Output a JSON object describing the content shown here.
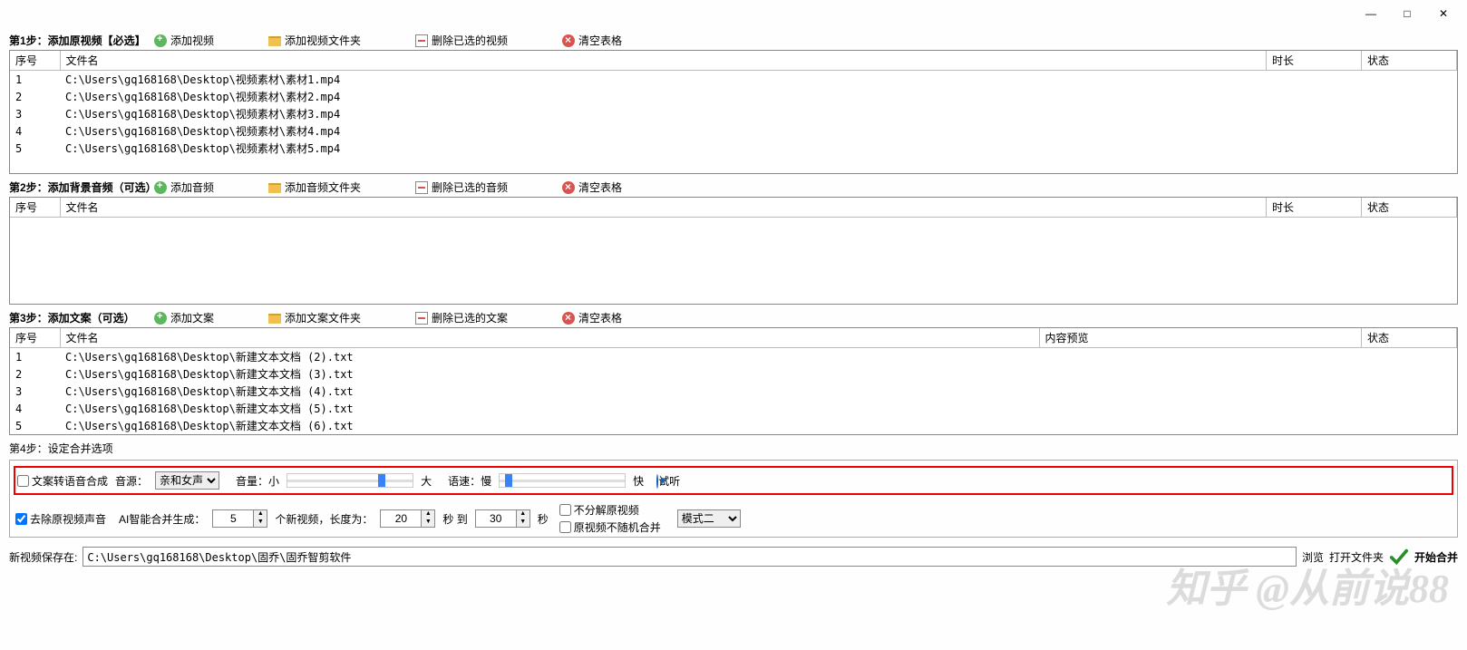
{
  "titlebar": {
    "min": "—",
    "max": "□",
    "close": "✕"
  },
  "step1": {
    "label": "第1步：添加原视频【必选】",
    "add": "添加视频",
    "add_folder": "添加视频文件夹",
    "delete_sel": "删除已选的视频",
    "clear": "清空表格",
    "cols": {
      "seq": "序号",
      "file": "文件名",
      "dur": "时长",
      "status": "状态"
    },
    "rows": [
      {
        "seq": "1",
        "file": "C:\\Users\\gq168168\\Desktop\\视频素材\\素材1.mp4"
      },
      {
        "seq": "2",
        "file": "C:\\Users\\gq168168\\Desktop\\视频素材\\素材2.mp4"
      },
      {
        "seq": "3",
        "file": "C:\\Users\\gq168168\\Desktop\\视频素材\\素材3.mp4"
      },
      {
        "seq": "4",
        "file": "C:\\Users\\gq168168\\Desktop\\视频素材\\素材4.mp4"
      },
      {
        "seq": "5",
        "file": "C:\\Users\\gq168168\\Desktop\\视频素材\\素材5.mp4"
      }
    ]
  },
  "step2": {
    "label": "第2步：添加背景音频（可选）",
    "add": "添加音频",
    "add_folder": "添加音频文件夹",
    "delete_sel": "删除已选的音频",
    "clear": "清空表格",
    "cols": {
      "seq": "序号",
      "file": "文件名",
      "dur": "时长",
      "status": "状态"
    }
  },
  "step3": {
    "label": "第3步：添加文案（可选）",
    "add": "添加文案",
    "add_folder": "添加文案文件夹",
    "delete_sel": "删除已选的文案",
    "clear": "清空表格",
    "cols": {
      "seq": "序号",
      "file": "文件名",
      "preview": "内容预览",
      "status": "状态"
    },
    "rows": [
      {
        "seq": "1",
        "file": "C:\\Users\\gq168168\\Desktop\\新建文本文档 (2).txt"
      },
      {
        "seq": "2",
        "file": "C:\\Users\\gq168168\\Desktop\\新建文本文档 (3).txt"
      },
      {
        "seq": "3",
        "file": "C:\\Users\\gq168168\\Desktop\\新建文本文档 (4).txt"
      },
      {
        "seq": "4",
        "file": "C:\\Users\\gq168168\\Desktop\\新建文本文档 (5).txt"
      },
      {
        "seq": "5",
        "file": "C:\\Users\\gq168168\\Desktop\\新建文本文档 (6).txt"
      }
    ]
  },
  "step4": {
    "label": "第4步：设定合并选项",
    "tts_chk": "文案转语音合成",
    "source_lbl": "音源：",
    "source_val": "亲和女声",
    "vol_lbl": "音量：",
    "small": "小",
    "big": "大",
    "speed_lbl": "语速：",
    "slow": "慢",
    "fast": "快",
    "preview": "试听",
    "remove_audio": "去除原视频声音",
    "ai_gen_lbl": "AI智能合并生成：",
    "count": "5",
    "count_suffix": "个新视频，长度为：",
    "from": "20",
    "mid": "秒 到",
    "to": "30",
    "sec": "秒",
    "no_split": "不分解原视频",
    "no_random": "原视频不随机合并",
    "mode": "模式二"
  },
  "save": {
    "label": "新视频保存在:",
    "path": "C:\\Users\\gq168168\\Desktop\\固乔\\固乔智剪软件",
    "browse": "浏览",
    "open_folder": "打开文件夹",
    "start": "开始合并"
  },
  "watermark": "知乎 @从前说88"
}
